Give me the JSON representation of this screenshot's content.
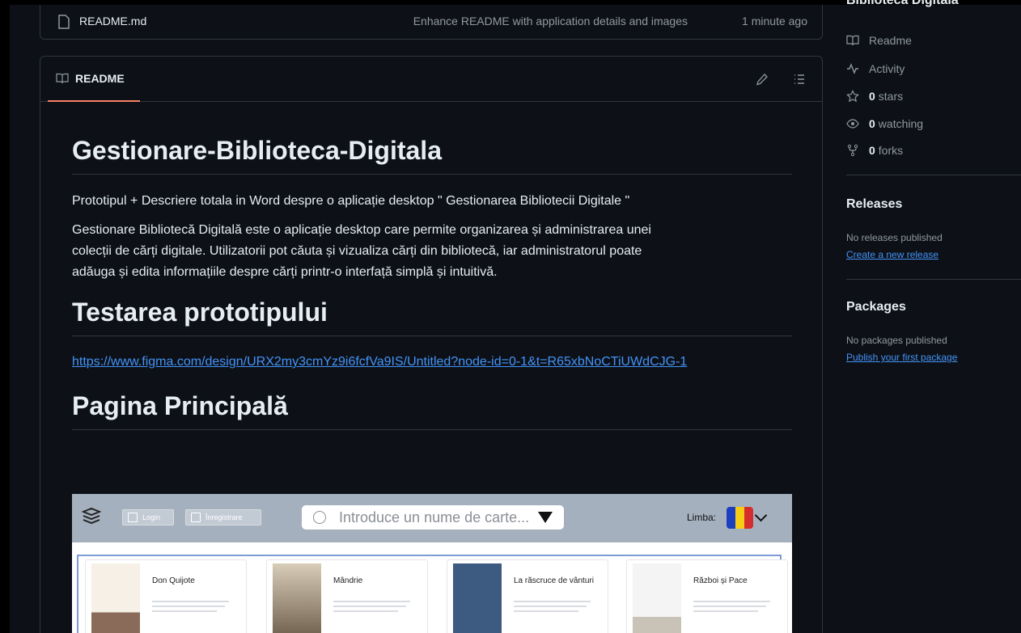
{
  "file_row": {
    "name": "README.md",
    "commit_message": "Enhance README with application details and images",
    "time": "1 minute ago"
  },
  "readme": {
    "tab_label": "README",
    "heading": "Gestionare-Biblioteca-Digitala",
    "intro": "Prototipul + Descriere totala in Word despre o aplicație desktop \" Gestionarea Bibliotecii Digitale \"",
    "desc_line1": "Gestionare Bibliotecă Digitală este o aplicație desktop care permite organizarea și administrarea unei",
    "desc_line2": "colecții de cărți digitale. Utilizatorii pot căuta și vizualiza cărți din bibliotecă, iar administratorul poate",
    "desc_line3": "adăuga și edita informațiile despre cărți printr-o interfață simplă și intuitivă.",
    "section1": "Testarea prototipului",
    "figma_link": "https://www.figma.com/design/URX2my3cmYz9i6fcfVa9IS/Untitled?node-id=0-1&t=R65xbNoCTiUWdCJG-1",
    "section2": "Pagina Principală"
  },
  "prototype": {
    "login": "Login",
    "register": "Înregistrare",
    "search_placeholder": "Introduce un nume de carte...",
    "language_label": "Limba:",
    "books": [
      "Don Quijote",
      "Mândrie",
      "La răscruce de vânturi",
      "Război și Pace"
    ]
  },
  "sidebar": {
    "cut_title": "Biblioteca Digitala",
    "readme": "Readme",
    "activity": "Activity",
    "stars_count": "0",
    "stars_label": "stars",
    "watching_count": "0",
    "watching_label": "watching",
    "forks_count": "0",
    "forks_label": "forks",
    "releases_title": "Releases",
    "releases_empty": "No releases published",
    "releases_link": "Create a new release",
    "packages_title": "Packages",
    "packages_empty": "No packages published",
    "packages_link": "Publish your first package"
  }
}
